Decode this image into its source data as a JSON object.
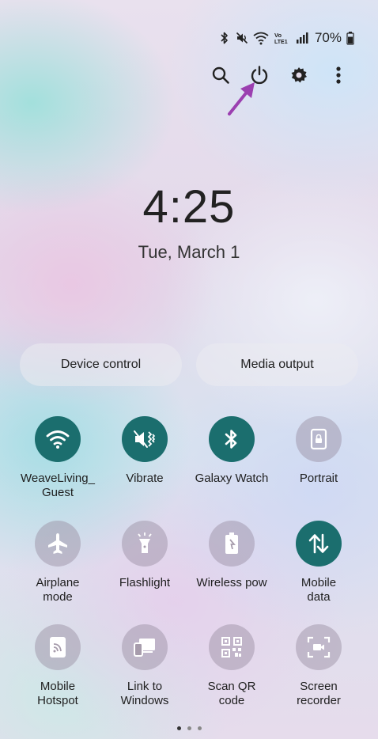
{
  "status_bar": {
    "battery": "70%",
    "icons": [
      "bluetooth-icon",
      "mute-icon",
      "wifi-icon",
      "volte-icon",
      "signal-icon",
      "battery-icon"
    ]
  },
  "top_actions": [
    "search-icon",
    "power-icon",
    "gear-icon",
    "more-vert-icon"
  ],
  "clock": {
    "time": "4:25",
    "date": "Tue, March 1"
  },
  "pills": {
    "device_control": "Device control",
    "media_output": "Media output"
  },
  "tiles": [
    {
      "label": "WeaveLiving_\nGuest",
      "icon": "wifi-icon",
      "active": true
    },
    {
      "label": "Vibrate",
      "icon": "vibrate-icon",
      "active": true
    },
    {
      "label": "Galaxy Watch",
      "icon": "bluetooth-icon",
      "active": true
    },
    {
      "label": "Portrait",
      "icon": "portrait-lock-icon",
      "active": false
    },
    {
      "label": "Airplane\nmode",
      "icon": "airplane-icon",
      "active": false
    },
    {
      "label": "Flashlight",
      "icon": "flashlight-icon",
      "active": false
    },
    {
      "label": "Wireless pow",
      "icon": "wireless-power-icon",
      "active": false
    },
    {
      "label": "Mobile\ndata",
      "icon": "mobile-data-icon",
      "active": true
    },
    {
      "label": "Mobile\nHotspot",
      "icon": "hotspot-icon",
      "active": false
    },
    {
      "label": "Link to\nWindows",
      "icon": "link-to-windows-icon",
      "active": false
    },
    {
      "label": "Scan QR\ncode",
      "icon": "qr-code-icon",
      "active": false
    },
    {
      "label": "Screen\nrecorder",
      "icon": "screen-recorder-icon",
      "active": false
    }
  ],
  "colors": {
    "tile_on": "#1b6e6e",
    "annotation_arrow": "#9b3fb0"
  },
  "page_indicator": {
    "count": 3,
    "active_index": 0
  }
}
